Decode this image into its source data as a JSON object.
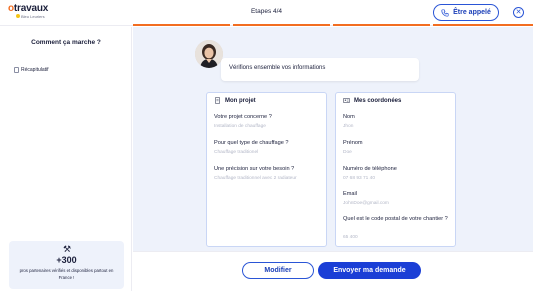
{
  "header": {
    "logo_text": "travaux",
    "logo_o": "o",
    "logo_sub": "Bleu Leuriers",
    "steps": "Etapes 4/4",
    "call_label": "Être appelé"
  },
  "sidebar": {
    "title": "Comment ça marche ?",
    "recap_label": "Récapitulatif",
    "partners_count": "+300",
    "partners_text": "pros partenaires vérifiés et disponibles partout en France !"
  },
  "main": {
    "bubble_text": "Vérifions ensemble vos informations",
    "project": {
      "title": "Mon projet",
      "items": [
        {
          "q": "Votre projet concerne ?",
          "a": "Installation de chauffage"
        },
        {
          "q": "Pour quel type de chauffage ?",
          "a": "Chauffage traditionel"
        },
        {
          "q": "Une précision sur votre besoin ?",
          "a": "Chauffage traditionnel avec 2 radiateur"
        }
      ]
    },
    "coords": {
      "title": "Mes coordonées",
      "items": [
        {
          "q": "Nom",
          "a": "Jhon"
        },
        {
          "q": "Prénom",
          "a": "Doe"
        },
        {
          "q": "Numéro de téléphone",
          "a": "07 68 93 71 40"
        },
        {
          "q": "Email",
          "a": "JohnDoe@gmail.com"
        },
        {
          "q": "Quel est le code postal de votre chantier ?",
          "a": "65 400"
        }
      ]
    }
  },
  "footer": {
    "modify_label": "Modifier",
    "send_label": "Envoyer ma demande"
  },
  "colors": {
    "accent": "#f26d21",
    "primary": "#1b3fd6",
    "background": "#eef2fb"
  }
}
